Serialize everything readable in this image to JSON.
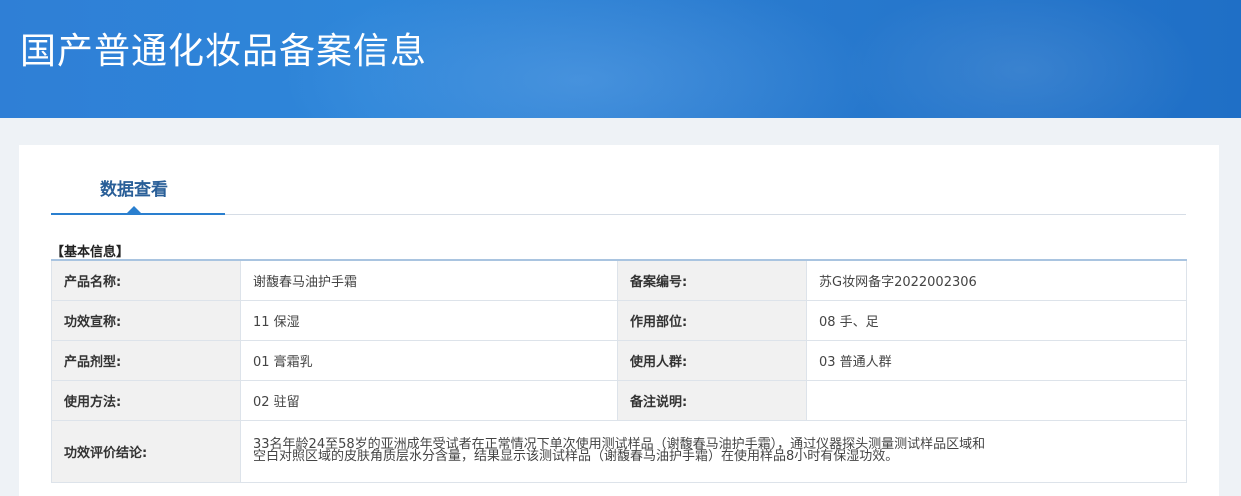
{
  "banner": {
    "title": "国产普通化妆品备案信息"
  },
  "tab": {
    "label": "数据查看"
  },
  "section": {
    "title": "【基本信息】"
  },
  "rows": [
    {
      "k1": "产品名称:",
      "v1": "谢馥春马油护手霜",
      "k2": "备案编号:",
      "v2": "苏G妆网备字2022002306"
    },
    {
      "k1": "功效宣称:",
      "v1": "11 保湿",
      "k2": "作用部位:",
      "v2": "08 手、足"
    },
    {
      "k1": "产品剂型:",
      "v1": "01 膏霜乳",
      "k2": "使用人群:",
      "v2": "03 普通人群"
    },
    {
      "k1": "使用方法:",
      "v1": "02 驻留",
      "k2": "备注说明:",
      "v2": ""
    }
  ],
  "conclusion": {
    "label": "功效评价结论:",
    "text": "33名年龄24至58岁的亚洲成年受试者在正常情况下单次使用测试样品（谢馥春马油护手霜），通过仪器探头测量测试样品区域和空白对照区域的皮肤角质层水分含量，结果显示该测试样品（谢馥春马油护手霜）在使用样品8小时有保湿功效。"
  }
}
